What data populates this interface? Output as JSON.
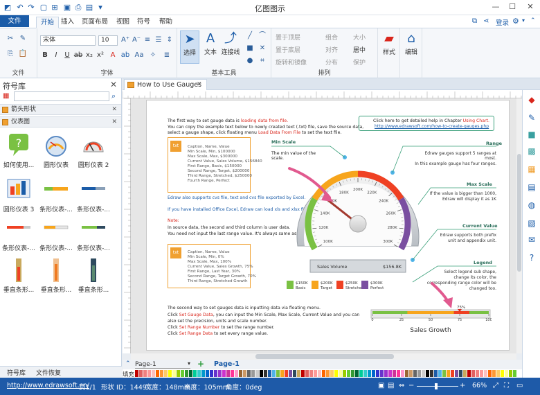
{
  "app": {
    "title": "亿图图示",
    "login": "登录"
  },
  "menu": {
    "file": "文件",
    "tabs": [
      "开始",
      "插入",
      "页面布局",
      "视图",
      "符号",
      "帮助"
    ]
  },
  "ribbon": {
    "font_name": "宋体",
    "font_size": "10",
    "groups": {
      "file": "文件",
      "font": "字体",
      "basic_tools": "基本工具",
      "arrange": "排列",
      "style": "样式",
      "edit": "编辑"
    },
    "tools": {
      "select": "选择",
      "text": "文本",
      "connector": "连接线"
    },
    "arrange": {
      "bring_front": "置于顶层",
      "send_back": "置于底层",
      "rotate": "旋转和镜像",
      "group": "组合",
      "align": "对齐",
      "distribute": "分布",
      "size": "大小",
      "center": "居中",
      "protect": "保护"
    },
    "style_label": "样式",
    "edit_label": "编辑"
  },
  "library": {
    "title": "符号库",
    "categories": [
      "箭头形状",
      "仪表图"
    ],
    "shapes": [
      {
        "label": "如何使用..."
      },
      {
        "label": "圆形仪表"
      },
      {
        "label": "圆形仪表 2"
      },
      {
        "label": "圆形仪表 3"
      },
      {
        "label": "条形仪表-..."
      },
      {
        "label": "条形仪表-..."
      },
      {
        "label": "条形仪表-..."
      },
      {
        "label": "条形仪表-..."
      },
      {
        "label": "条形仪表-..."
      },
      {
        "label": "垂直条形..."
      },
      {
        "label": "垂直条形..."
      },
      {
        "label": "垂直条形..."
      }
    ],
    "bottom_tabs": [
      "符号库",
      "文件恢复"
    ]
  },
  "document": {
    "tab_title": "How to Use Gauges"
  },
  "content": {
    "intro1a": "The first way to set gauge data is ",
    "intro1b": "loading data from file.",
    "intro2": "You can copy the example text below to newly created text (.txt) file, save the source data,",
    "intro3a": "select a gauge shape, click floating menu ",
    "intro3b": "Load Data From File",
    "intro3c": " to set the text file.",
    "box1": [
      "Caption, Name, Value",
      "Min Scale, Min, $100000",
      "Max Scale, Max, $300000",
      "Current Value, Sales Volume, $156840",
      "First Range, Basic, $150000",
      "Second Range, Target, $200000",
      "Third Range, Stretched, $250000",
      "Fourth Range, Perfect"
    ],
    "csv1": "Edraw also supports cvs file, text and cvs file exported by Excel.",
    "csv2": "If you have installed Office Excel, Edraw can load xls and xlsx file.",
    "note": "Note:",
    "note1": "In source data, the second and third column is user data.",
    "note2": "You need not input the last range value. It's always same as Max scale value.",
    "box2": [
      "Caption, Name, Value",
      "Min Scale, Min, 0%",
      "Max Scale, Max, 100%",
      "Current Value, Sales Growth, 75%",
      "First Range, Last Year, 30%",
      "Second Range, Target Growth, 70%",
      "Third Range, Stretched Growth"
    ],
    "way2": "The second way to set gauges data is inputting data via floating menu.",
    "way2a1": "Click ",
    "way2a2": "Set Gauge Data",
    "way2a3": ", you can input the Min Scale, Max Scale, Current Value and you can",
    "way2b": "also set the precision, units and scale number.",
    "way2c1": "Click ",
    "way2c2": "Set Range Number",
    "way2c3": " to set the range number.",
    "way2d1": "Click ",
    "way2d2": "Set Range Data",
    "way2d3": " to set every range value.",
    "help1a": "Click here to get detailed help in Chapter ",
    "help1b": "Using Chart.",
    "help_url": "http://www.edrawsoft.com/how-to-create-gauges.php",
    "min_scale_title": "Min Scale",
    "min_scale_desc": [
      "The min value of the",
      "scale."
    ],
    "range_title": "Range",
    "range_desc": [
      "Edraw gauges support 5 ranges at",
      "most.",
      "In this example gauge has four ranges."
    ],
    "max_scale_title": "Max Scale",
    "max_scale_desc": [
      "If the value is bigger than 1000,",
      "Edraw will display it as 1K"
    ],
    "current_title": "Current Value",
    "current_desc": [
      "Edraw supports both prefix",
      "unit and appendix unit."
    ],
    "legend_title": "Legend",
    "legend_desc": [
      "Select legend sub shape,",
      "change its color, the",
      "corresponding range color will be",
      "changed too."
    ]
  },
  "gauge": {
    "ticks": [
      "100K",
      "120K",
      "140K",
      "160K",
      "180K",
      "200K",
      "220K",
      "240K",
      "260K",
      "280K",
      "300K"
    ],
    "min": 100000,
    "max": 300000,
    "value": 156840,
    "caption": "Sales Volume",
    "value_label": "$156.8K",
    "ranges": [
      {
        "to": 150000,
        "color": "#7ac143"
      },
      {
        "to": 200000,
        "color": "#f7a51c"
      },
      {
        "to": 250000,
        "color": "#ef4123"
      },
      {
        "to": 300000,
        "color": "#7a4fa0"
      }
    ],
    "legend": [
      {
        "value": "$150K",
        "name": "Basic",
        "color": "#7ac143"
      },
      {
        "value": "$200K",
        "name": "Target",
        "color": "#f7a51c"
      },
      {
        "value": "$250K",
        "name": "Stretched",
        "color": "#ef4123"
      },
      {
        "value": "$300K",
        "name": "Perfect",
        "color": "#7a4fa0"
      }
    ]
  },
  "bar_gauge": {
    "title": "Sales Growth",
    "value": 75,
    "value_label": "75%",
    "ticks": [
      "0",
      "25",
      "50",
      "75",
      "100"
    ]
  },
  "pagebar": {
    "page_select": "Page-1",
    "page_tab": "Page-1",
    "fill_label": "填充"
  },
  "status": {
    "url": "http://www.edrawsoft.cn/",
    "page": "页1/1",
    "shape_id": "形状 ID：1449",
    "width": "宽度：148mm",
    "height": "高度：105mm",
    "angle": "角度：0deg",
    "zoom": "66%"
  }
}
